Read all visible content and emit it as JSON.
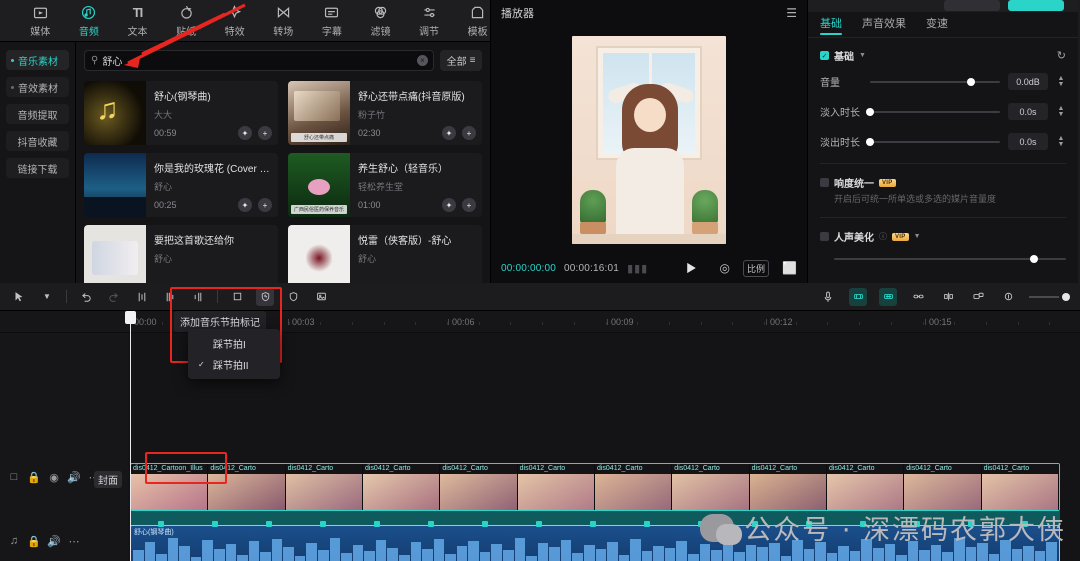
{
  "toolbar": {
    "tabs": [
      {
        "label": "媒体",
        "icon": "media-icon",
        "active": false
      },
      {
        "label": "音频",
        "icon": "audio-icon",
        "active": true
      },
      {
        "label": "文本",
        "icon": "text-icon",
        "active": false
      },
      {
        "label": "贴纸",
        "icon": "sticker-icon",
        "active": false
      },
      {
        "label": "特效",
        "icon": "effects-icon",
        "active": false
      },
      {
        "label": "转场",
        "icon": "transition-icon",
        "active": false
      },
      {
        "label": "字幕",
        "icon": "caption-icon",
        "active": false
      },
      {
        "label": "滤镜",
        "icon": "filter-icon",
        "active": false
      },
      {
        "label": "调节",
        "icon": "adjust-icon",
        "active": false
      },
      {
        "label": "模板",
        "icon": "template-icon",
        "active": false
      }
    ]
  },
  "sidebar": {
    "items": [
      {
        "label": "音乐素材",
        "active": true
      },
      {
        "label": "音效素材",
        "active": false
      },
      {
        "label": "音频提取",
        "active": false
      },
      {
        "label": "抖音收藏",
        "active": false
      },
      {
        "label": "链接下载",
        "active": false
      }
    ]
  },
  "search": {
    "value": "舒心",
    "placeholder": "搜索",
    "icon": "search-icon",
    "clear_icon": "×",
    "filter_label": "全部",
    "filter_icon": "sort-icon"
  },
  "music_list": [
    {
      "title": "舒心(钢琴曲)",
      "artist": "大大",
      "duration": "00:59",
      "thumb": "th-notes",
      "tag": ""
    },
    {
      "title": "舒心还带点痛(抖音原版)",
      "artist": "粉子竹",
      "duration": "02:30",
      "thumb": "th-room",
      "tag": "舒心还带点痛"
    },
    {
      "title": "你是我的玫瑰花 (Cover 庞龙)",
      "artist": "舒心",
      "duration": "00:25",
      "thumb": "th-night",
      "tag": ""
    },
    {
      "title": "养生舒心（轻音乐）",
      "artist": "轻松养生堂",
      "duration": "01:00",
      "thumb": "th-lotus",
      "tag": "广西民俗医药保养音乐"
    },
    {
      "title": "要把这首歌还给你",
      "artist": "舒心",
      "duration": "",
      "thumb": "th-anime",
      "tag": ""
    },
    {
      "title": "悦雷（侠客版）-舒心",
      "artist": "舒心",
      "duration": "",
      "thumb": "th-ink",
      "tag": ""
    }
  ],
  "player": {
    "title": "播放器",
    "menu_icon": "list-icon",
    "current_time": "00:00:00:00",
    "total_time": "00:00:16:01",
    "play_icon": "play-icon",
    "focus_icon": "focus-icon",
    "ratio_label": "比例",
    "fullscreen_icon": "fullscreen-icon"
  },
  "props": {
    "tabs": [
      {
        "label": "基础",
        "active": true
      },
      {
        "label": "声音效果",
        "active": false
      },
      {
        "label": "变速",
        "active": false
      }
    ],
    "section_title": "基础",
    "reset_icon": "reset-icon",
    "rows": [
      {
        "label": "音量",
        "value": "0.0dB",
        "knob_pct": 78
      },
      {
        "label": "淡入时长",
        "value": "0.0s",
        "knob_pct": 0
      },
      {
        "label": "淡出时长",
        "value": "0.0s",
        "knob_pct": 0
      }
    ],
    "loudness": {
      "label": "响度统一",
      "badge": "VIP",
      "hint": "开启后可统一所单选或多选的媒片音量度"
    },
    "beautify": {
      "label": "人声美化",
      "badge": "VIP",
      "knob_pct": 86
    }
  },
  "timeline": {
    "tools": [
      {
        "name": "select-tool",
        "icon": "cursor-icon",
        "state": "normal"
      },
      {
        "name": "select-dropdown",
        "icon": "chevron-down-icon",
        "state": "normal"
      },
      {
        "name": "undo-tool",
        "icon": "undo-icon",
        "state": "normal"
      },
      {
        "name": "redo-tool",
        "icon": "redo-icon",
        "state": "disabled"
      },
      {
        "name": "split-tool",
        "icon": "split-icon",
        "state": "normal"
      },
      {
        "name": "trim-left-tool",
        "icon": "trim-left-icon",
        "state": "normal"
      },
      {
        "name": "trim-right-tool",
        "icon": "trim-right-icon",
        "state": "normal"
      },
      {
        "name": "crop-tool",
        "icon": "crop-icon",
        "state": "normal"
      },
      {
        "name": "beat-tool",
        "icon": "shield-beat-icon",
        "state": "selected"
      },
      {
        "name": "mirror-tool",
        "icon": "shield-icon",
        "state": "normal"
      },
      {
        "name": "freeze-tool",
        "icon": "image-icon",
        "state": "normal"
      }
    ],
    "right_tools": [
      {
        "name": "record-tool",
        "icon": "mic-icon",
        "state": "normal"
      },
      {
        "name": "snap-a-tool",
        "icon": "magnet-a-icon",
        "state": "on"
      },
      {
        "name": "snap-b-tool",
        "icon": "magnet-b-icon",
        "state": "on"
      },
      {
        "name": "link-tool",
        "icon": "link-icon",
        "state": "normal"
      },
      {
        "name": "mirror-split-tool",
        "icon": "mirror-split-icon",
        "state": "normal"
      },
      {
        "name": "preview-tool",
        "icon": "preview-icon",
        "state": "normal"
      },
      {
        "name": "zoom-fit-tool",
        "icon": "zoom-fit-icon",
        "state": "normal"
      }
    ],
    "ruler_marks": [
      "00:00",
      "00:03",
      "00:06",
      "00:09",
      "00:12",
      "00:15"
    ],
    "tooltip": "添加音乐节拍标记",
    "menu_items": [
      {
        "label": "踩节拍I",
        "checked": false
      },
      {
        "label": "踩节拍II",
        "checked": true
      }
    ],
    "video_clips": [
      "dis0412_Cartoon_Illus",
      "dis0412_Carto",
      "dis0412_Carto",
      "dis0412_Carto",
      "dis0412_Carto",
      "dis0412_Carto",
      "dis0412_Carto",
      "dis0412_Carto",
      "dis0412_Carto",
      "dis0412_Carto",
      "dis0412_Carto",
      "dis0412_Carto"
    ],
    "audio_clip_name": "舒心(钢琴曲)",
    "cover_label": "封面",
    "track_header_icons_video": [
      "lock-open-icon",
      "lock-icon",
      "eye-icon",
      "volume-icon",
      "more-icon"
    ],
    "track_header_icons_audio": [
      "music-icon",
      "lock-icon",
      "volume-icon",
      "more-icon"
    ]
  },
  "watermark": {
    "icon": "wechat-icon",
    "text": "公众号 · 深漂码农郭大侠"
  }
}
